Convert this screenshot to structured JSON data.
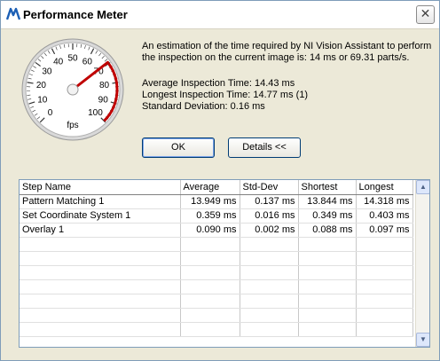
{
  "window": {
    "title": "Performance Meter"
  },
  "gauge": {
    "tick_labels": [
      "0",
      "10",
      "20",
      "30",
      "40",
      "50",
      "60",
      "70",
      "80",
      "90",
      "100"
    ],
    "unit": "fps",
    "value": 69.31,
    "needle_color": "#c00000",
    "redline_color": "#c00000"
  },
  "info": {
    "line1": "An estimation of the time required by NI Vision Assistant to perform",
    "line2": "the inspection on the current image is:  14 ms or 69.31 parts/s.",
    "avg": "Average Inspection Time:  14.43 ms",
    "longest": "Longest Inspection Time:  14.77 ms (1)",
    "std": "Standard Deviation: 0.16 ms"
  },
  "buttons": {
    "ok": "OK",
    "details": "Details <<"
  },
  "table": {
    "headers": [
      "Step Name",
      "Average",
      "Std-Dev",
      "Shortest",
      "Longest"
    ],
    "rows": [
      [
        "Pattern Matching 1",
        "13.949 ms",
        "0.137 ms",
        "13.844 ms",
        "14.318 ms"
      ],
      [
        "Set Coordinate System 1",
        "0.359 ms",
        "0.016 ms",
        "0.349 ms",
        "0.403 ms"
      ],
      [
        "Overlay 1",
        "0.090 ms",
        "0.002 ms",
        "0.088 ms",
        "0.097 ms"
      ]
    ],
    "empty_rows": 7
  },
  "scrollbar": {
    "up_icon": "▲",
    "down_icon": "▼"
  }
}
